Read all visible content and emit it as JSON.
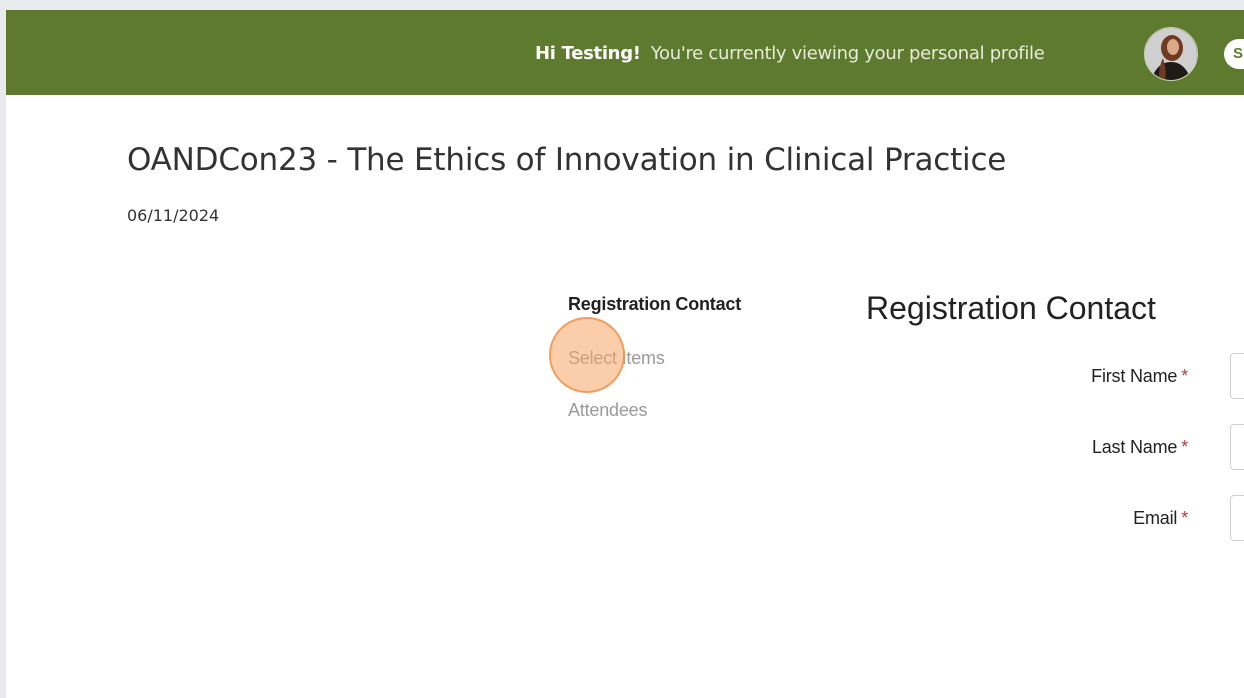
{
  "header": {
    "greeting_bold": "Hi Testing!",
    "greeting_message": "You're currently viewing your personal profile",
    "avatar_icon": "user-avatar-photo",
    "user_initial": "S",
    "colors": {
      "bar": "#5e7a2e",
      "text": "#ffffff"
    }
  },
  "event": {
    "title": "OANDCon23 - The Ethics of Innovation in Clinical Practice",
    "date": "06/11/2024"
  },
  "steps": [
    {
      "label": "Registration Contact",
      "state": "active"
    },
    {
      "label": "Select Items",
      "state": "inactive"
    },
    {
      "label": "Attendees",
      "state": "inactive"
    }
  ],
  "form": {
    "heading": "Registration Contact",
    "required_marker": "*",
    "fields": [
      {
        "label": "First Name",
        "value": ""
      },
      {
        "label": "Last Name",
        "value": ""
      },
      {
        "label": "Email",
        "value": ""
      }
    ]
  },
  "click_marker_color": "#f7a666"
}
